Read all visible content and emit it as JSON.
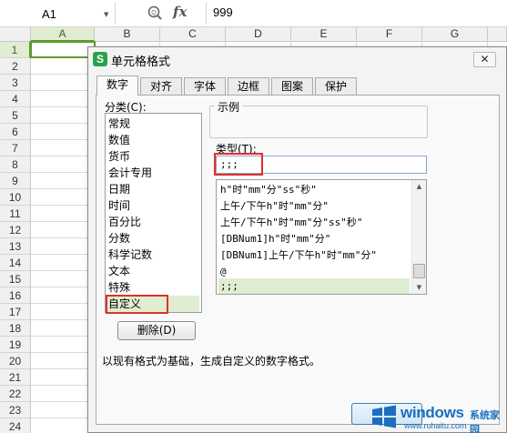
{
  "formula_bar": {
    "cell_ref": "A1",
    "dropdown_icon": "chevron-down-icon",
    "zoom_icon": "zoom-icon",
    "fx": "fx",
    "value": "999"
  },
  "grid": {
    "columns": [
      "A",
      "B",
      "C",
      "D",
      "E",
      "F",
      "G"
    ],
    "rows": [
      "1",
      "2",
      "3",
      "4",
      "5",
      "6",
      "7",
      "8",
      "9",
      "10",
      "11",
      "12",
      "13",
      "14",
      "15",
      "16",
      "17",
      "18",
      "19",
      "20",
      "21",
      "22",
      "23",
      "24"
    ],
    "selected_column": "A",
    "selected_row": "1"
  },
  "dialog": {
    "title": "单元格格式",
    "app_icon": "S",
    "close_label": "✕",
    "tabs": [
      "数字",
      "对齐",
      "字体",
      "边框",
      "图案",
      "保护"
    ],
    "active_tab": "数字",
    "category_label": "分类(C):",
    "categories": [
      "常规",
      "数值",
      "货币",
      "会计专用",
      "日期",
      "时间",
      "百分比",
      "分数",
      "科学记数",
      "文本",
      "特殊",
      "自定义"
    ],
    "selected_category": "自定义",
    "sample_label": "示例",
    "type_label": "类型(T):",
    "type_value": ";;;",
    "formats": [
      "h\"时\"mm\"分\"ss\"秒\"",
      "上午/下午h\"时\"mm\"分\"",
      "上午/下午h\"时\"mm\"分\"ss\"秒\"",
      "[DBNum1]h\"时\"mm\"分\"",
      "[DBNum1]上午/下午h\"时\"mm\"分\"",
      "@",
      ";;;"
    ],
    "selected_format": ";;;",
    "delete_label": "删除(D)",
    "description": "以现有格式为基础，生成自定义的数字格式。"
  },
  "watermark": {
    "brand": "windows",
    "sub": "系统家园",
    "url": "www.ruhaitu.com"
  },
  "colors": {
    "accent_green": "#5b9b2c",
    "highlight_red": "#e0302a",
    "selection_bg": "#dfeed0"
  }
}
